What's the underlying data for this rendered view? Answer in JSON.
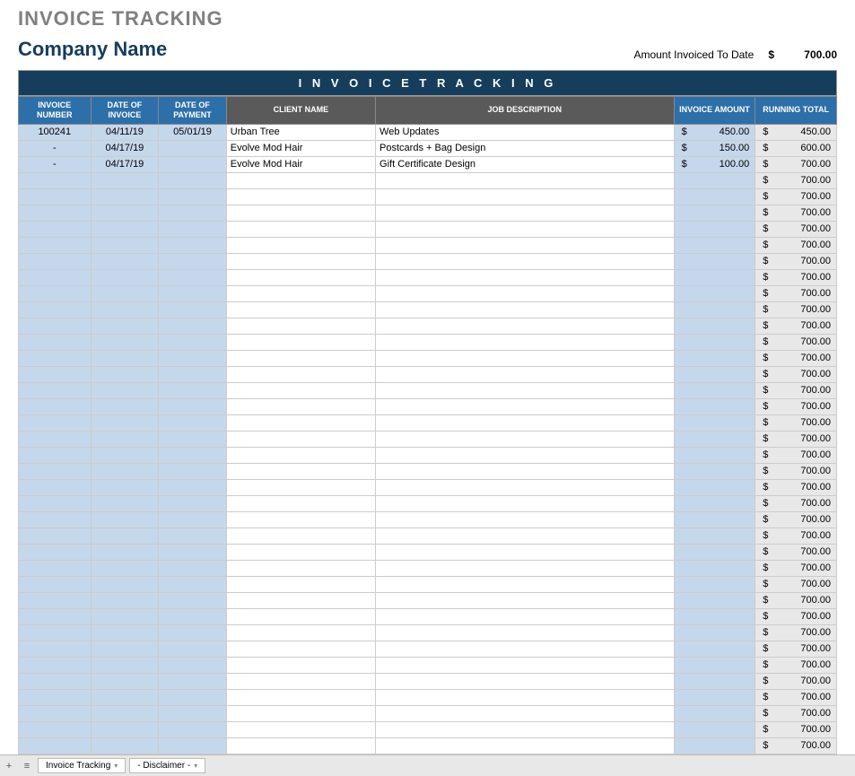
{
  "page_title": "INVOICE TRACKING",
  "company_name": "Company Name",
  "summary": {
    "label": "Amount Invoiced To Date",
    "currency": "$",
    "value": "700.00"
  },
  "banner": "I N V O I C E   T R A C K I N G",
  "columns": {
    "invoice_number": "INVOICE NUMBER",
    "date_of_invoice": "DATE OF INVOICE",
    "date_of_payment": "DATE OF PAYMENT",
    "client_name": "CLIENT NAME",
    "job_description": "JOB DESCRIPTION",
    "invoice_amount": "INVOICE AMOUNT",
    "running_total": "RUNNING TOTAL"
  },
  "rows": [
    {
      "num": "100241",
      "inv_date": "04/11/19",
      "pay_date": "05/01/19",
      "client": "Urban Tree",
      "job": "Web Updates",
      "amount": "450.00",
      "running": "450.00"
    },
    {
      "num": "-",
      "inv_date": "04/17/19",
      "pay_date": "",
      "client": "Evolve Mod Hair",
      "job": "Postcards + Bag Design",
      "amount": "150.00",
      "running": "600.00"
    },
    {
      "num": "-",
      "inv_date": "04/17/19",
      "pay_date": "",
      "client": "Evolve Mod Hair",
      "job": "Gift Certificate Design",
      "amount": "100.00",
      "running": "700.00"
    },
    {
      "num": "",
      "inv_date": "",
      "pay_date": "",
      "client": "",
      "job": "",
      "amount": "",
      "running": "700.00"
    },
    {
      "num": "",
      "inv_date": "",
      "pay_date": "",
      "client": "",
      "job": "",
      "amount": "",
      "running": "700.00"
    },
    {
      "num": "",
      "inv_date": "",
      "pay_date": "",
      "client": "",
      "job": "",
      "amount": "",
      "running": "700.00"
    },
    {
      "num": "",
      "inv_date": "",
      "pay_date": "",
      "client": "",
      "job": "",
      "amount": "",
      "running": "700.00"
    },
    {
      "num": "",
      "inv_date": "",
      "pay_date": "",
      "client": "",
      "job": "",
      "amount": "",
      "running": "700.00"
    },
    {
      "num": "",
      "inv_date": "",
      "pay_date": "",
      "client": "",
      "job": "",
      "amount": "",
      "running": "700.00"
    },
    {
      "num": "",
      "inv_date": "",
      "pay_date": "",
      "client": "",
      "job": "",
      "amount": "",
      "running": "700.00"
    },
    {
      "num": "",
      "inv_date": "",
      "pay_date": "",
      "client": "",
      "job": "",
      "amount": "",
      "running": "700.00"
    },
    {
      "num": "",
      "inv_date": "",
      "pay_date": "",
      "client": "",
      "job": "",
      "amount": "",
      "running": "700.00"
    },
    {
      "num": "",
      "inv_date": "",
      "pay_date": "",
      "client": "",
      "job": "",
      "amount": "",
      "running": "700.00"
    },
    {
      "num": "",
      "inv_date": "",
      "pay_date": "",
      "client": "",
      "job": "",
      "amount": "",
      "running": "700.00"
    },
    {
      "num": "",
      "inv_date": "",
      "pay_date": "",
      "client": "",
      "job": "",
      "amount": "",
      "running": "700.00"
    },
    {
      "num": "",
      "inv_date": "",
      "pay_date": "",
      "client": "",
      "job": "",
      "amount": "",
      "running": "700.00"
    },
    {
      "num": "",
      "inv_date": "",
      "pay_date": "",
      "client": "",
      "job": "",
      "amount": "",
      "running": "700.00"
    },
    {
      "num": "",
      "inv_date": "",
      "pay_date": "",
      "client": "",
      "job": "",
      "amount": "",
      "running": "700.00"
    },
    {
      "num": "",
      "inv_date": "",
      "pay_date": "",
      "client": "",
      "job": "",
      "amount": "",
      "running": "700.00"
    },
    {
      "num": "",
      "inv_date": "",
      "pay_date": "",
      "client": "",
      "job": "",
      "amount": "",
      "running": "700.00"
    },
    {
      "num": "",
      "inv_date": "",
      "pay_date": "",
      "client": "",
      "job": "",
      "amount": "",
      "running": "700.00"
    },
    {
      "num": "",
      "inv_date": "",
      "pay_date": "",
      "client": "",
      "job": "",
      "amount": "",
      "running": "700.00"
    },
    {
      "num": "",
      "inv_date": "",
      "pay_date": "",
      "client": "",
      "job": "",
      "amount": "",
      "running": "700.00"
    },
    {
      "num": "",
      "inv_date": "",
      "pay_date": "",
      "client": "",
      "job": "",
      "amount": "",
      "running": "700.00"
    },
    {
      "num": "",
      "inv_date": "",
      "pay_date": "",
      "client": "",
      "job": "",
      "amount": "",
      "running": "700.00"
    },
    {
      "num": "",
      "inv_date": "",
      "pay_date": "",
      "client": "",
      "job": "",
      "amount": "",
      "running": "700.00"
    },
    {
      "num": "",
      "inv_date": "",
      "pay_date": "",
      "client": "",
      "job": "",
      "amount": "",
      "running": "700.00"
    },
    {
      "num": "",
      "inv_date": "",
      "pay_date": "",
      "client": "",
      "job": "",
      "amount": "",
      "running": "700.00"
    },
    {
      "num": "",
      "inv_date": "",
      "pay_date": "",
      "client": "",
      "job": "",
      "amount": "",
      "running": "700.00"
    },
    {
      "num": "",
      "inv_date": "",
      "pay_date": "",
      "client": "",
      "job": "",
      "amount": "",
      "running": "700.00"
    },
    {
      "num": "",
      "inv_date": "",
      "pay_date": "",
      "client": "",
      "job": "",
      "amount": "",
      "running": "700.00"
    },
    {
      "num": "",
      "inv_date": "",
      "pay_date": "",
      "client": "",
      "job": "",
      "amount": "",
      "running": "700.00"
    },
    {
      "num": "",
      "inv_date": "",
      "pay_date": "",
      "client": "",
      "job": "",
      "amount": "",
      "running": "700.00"
    },
    {
      "num": "",
      "inv_date": "",
      "pay_date": "",
      "client": "",
      "job": "",
      "amount": "",
      "running": "700.00"
    },
    {
      "num": "",
      "inv_date": "",
      "pay_date": "",
      "client": "",
      "job": "",
      "amount": "",
      "running": "700.00"
    },
    {
      "num": "",
      "inv_date": "",
      "pay_date": "",
      "client": "",
      "job": "",
      "amount": "",
      "running": "700.00"
    },
    {
      "num": "",
      "inv_date": "",
      "pay_date": "",
      "client": "",
      "job": "",
      "amount": "",
      "running": "700.00"
    },
    {
      "num": "",
      "inv_date": "",
      "pay_date": "",
      "client": "",
      "job": "",
      "amount": "",
      "running": "700.00"
    },
    {
      "num": "",
      "inv_date": "",
      "pay_date": "",
      "client": "",
      "job": "",
      "amount": "",
      "running": "700.00"
    }
  ],
  "currency_symbol": "$",
  "footer": {
    "add": "+",
    "menu": "≡",
    "tabs": [
      {
        "label": "Invoice Tracking"
      },
      {
        "label": "- Disclaimer -"
      }
    ]
  }
}
